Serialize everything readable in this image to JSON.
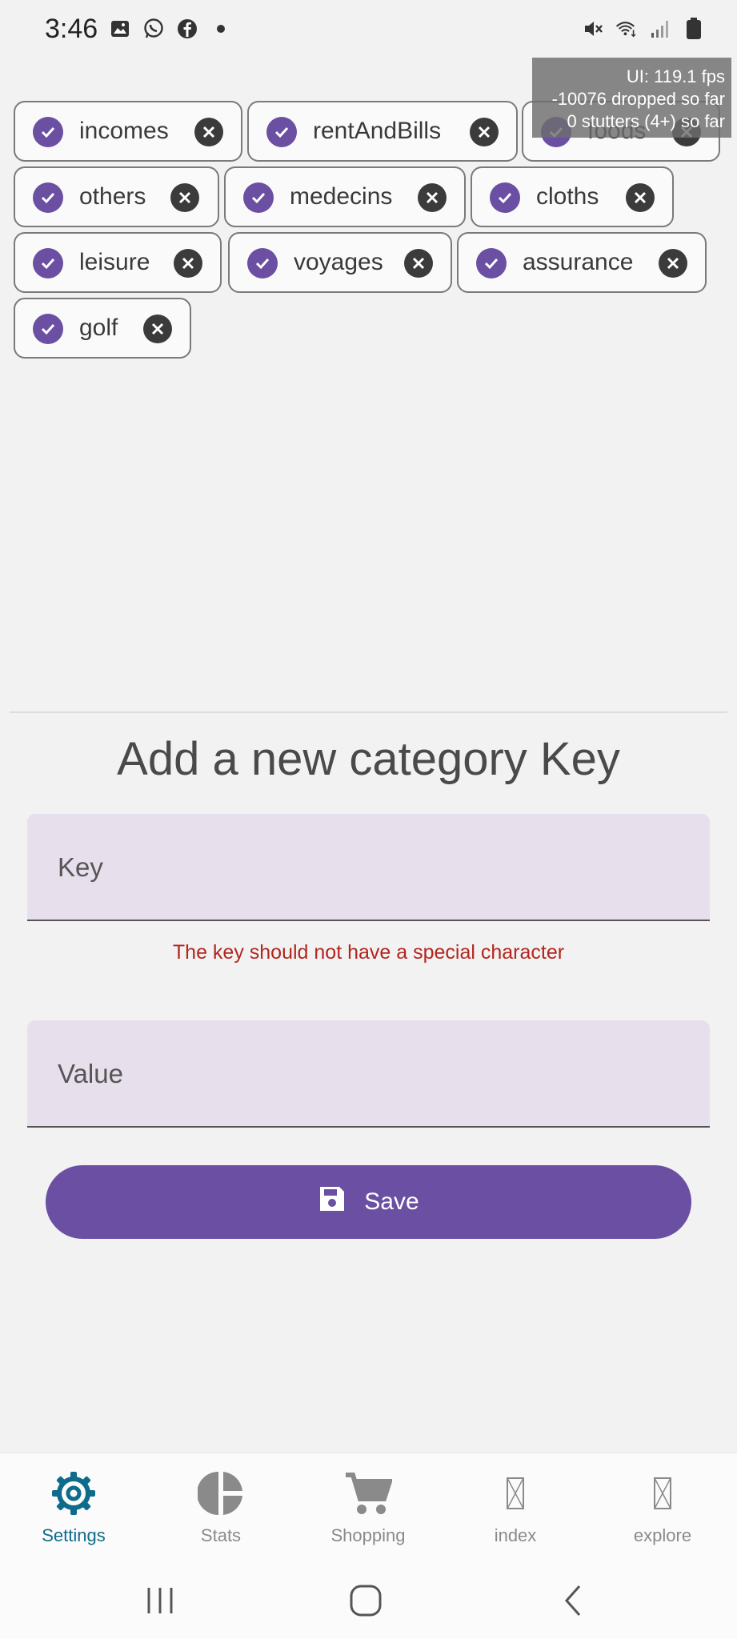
{
  "status_bar": {
    "time": "3:46",
    "left_icons": [
      "image-icon",
      "whatsapp-icon",
      "facebook-icon",
      "dot-icon"
    ],
    "right_icons": [
      "mute-icon",
      "wifi-icon",
      "signal-icon",
      "battery-icon"
    ]
  },
  "perf_overlay": {
    "line1": "UI: 119.1 fps",
    "line2": "-10076 dropped so far",
    "line3": "0 stutters (4+) so far"
  },
  "chips": [
    {
      "label": "incomes"
    },
    {
      "label": "rentAndBills"
    },
    {
      "label": "foods"
    },
    {
      "label": "others"
    },
    {
      "label": "medecins"
    },
    {
      "label": "cloths"
    },
    {
      "label": "leisure"
    },
    {
      "label": "voyages"
    },
    {
      "label": "assurance"
    },
    {
      "label": "golf"
    }
  ],
  "form": {
    "title": "Add a new category Key",
    "key_placeholder": "Key",
    "key_error": "The key should not have a special character",
    "value_placeholder": "Value",
    "save_label": "Save"
  },
  "bottom_nav": [
    {
      "label": "Settings",
      "icon": "gear-icon",
      "active": true
    },
    {
      "label": "Stats",
      "icon": "pie-chart-icon",
      "active": false
    },
    {
      "label": "Shopping",
      "icon": "cart-icon",
      "active": false
    },
    {
      "label": "index",
      "icon": "missing-glyph-icon",
      "active": false
    },
    {
      "label": "explore",
      "icon": "missing-glyph-icon",
      "active": false
    }
  ],
  "colors": {
    "accent": "#6a4fa3",
    "active_nav": "#0f6b8a",
    "error": "#b3261e",
    "field_bg": "#e7dfec"
  }
}
